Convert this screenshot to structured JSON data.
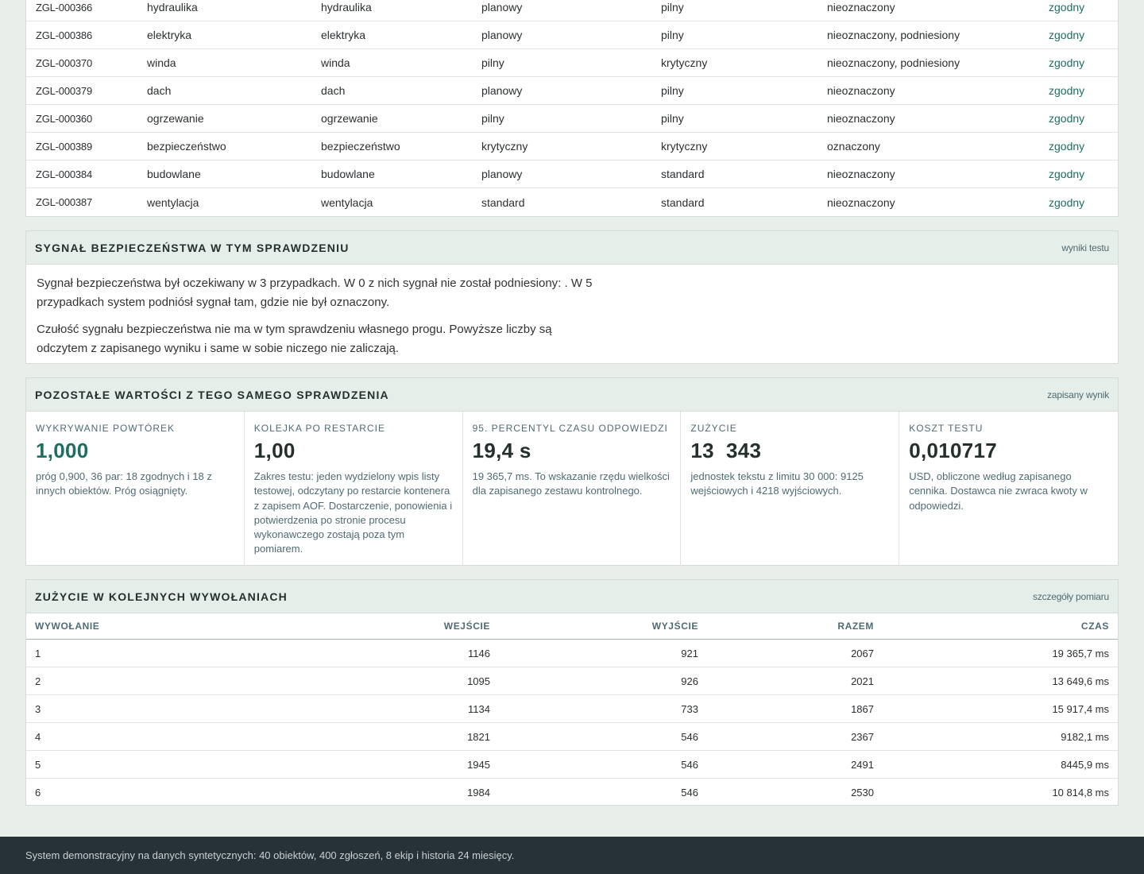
{
  "cases": [
    {
      "id": "ZGL-000366",
      "c2": "hydraulika",
      "c3": "hydraulika",
      "c4": "planowy",
      "c5": "pilny",
      "c6": "nieoznaczony",
      "c7": "zgodny"
    },
    {
      "id": "ZGL-000386",
      "c2": "elektryka",
      "c3": "elektryka",
      "c4": "planowy",
      "c5": "pilny",
      "c6": "nieoznaczony, podniesiony",
      "c7": "zgodny"
    },
    {
      "id": "ZGL-000370",
      "c2": "winda",
      "c3": "winda",
      "c4": "pilny",
      "c5": "krytyczny",
      "c6": "nieoznaczony, podniesiony",
      "c7": "zgodny"
    },
    {
      "id": "ZGL-000379",
      "c2": "dach",
      "c3": "dach",
      "c4": "planowy",
      "c5": "pilny",
      "c6": "nieoznaczony",
      "c7": "zgodny"
    },
    {
      "id": "ZGL-000360",
      "c2": "ogrzewanie",
      "c3": "ogrzewanie",
      "c4": "pilny",
      "c5": "pilny",
      "c6": "nieoznaczony",
      "c7": "zgodny"
    },
    {
      "id": "ZGL-000389",
      "c2": "bezpieczeństwo",
      "c3": "bezpieczeństwo",
      "c4": "krytyczny",
      "c5": "krytyczny",
      "c6": "oznaczony",
      "c7": "zgodny"
    },
    {
      "id": "ZGL-000384",
      "c2": "budowlane",
      "c3": "budowlane",
      "c4": "planowy",
      "c5": "standard",
      "c6": "nieoznaczony",
      "c7": "zgodny"
    },
    {
      "id": "ZGL-000387",
      "c2": "wentylacja",
      "c3": "wentylacja",
      "c4": "standard",
      "c5": "standard",
      "c6": "nieoznaczony",
      "c7": "zgodny"
    }
  ],
  "signal": {
    "title": "Sygnał bezpieczeństwa w tym sprawdzeniu",
    "tag": "wyniki testu",
    "p1": "Sygnał bezpieczeństwa był oczekiwany w 3 przypadkach. W 0 z nich sygnał nie został podniesiony: . W 5 przypadkach system podniósł sygnał tam, gdzie nie był oznaczony.",
    "p2": "Czułość sygnału bezpieczeństwa nie ma w tym sprawdzeniu własnego progu. Powyższe liczby są odczytem z zapisanego wyniku i same w sobie niczego nie zaliczają."
  },
  "other": {
    "title": "Pozostałe wartości z tego samego sprawdzenia",
    "tag": "zapisany wynik",
    "metrics": [
      {
        "label": "Wykrywanie powtórek",
        "value": "1,000",
        "desc": "próg 0,900, 36 par: 18 zgodnych i 18 z innych obiektów. Próg osiągnięty."
      },
      {
        "label": "Kolejka po restarcie",
        "value": "1,00",
        "desc": "Zakres testu: jeden wydzielony wpis listy testowej, odczytany po restarcie kontenera z zapisem AOF. Dostarczenie, ponowienia i potwierdzenia po stronie procesu wykonawczego zostają poza tym pomiarem."
      },
      {
        "label": "95. percentyl czasu odpowiedzi",
        "value": "19,4 s",
        "desc": "19 365,7 ms. To wskazanie rzędu wielkości dla zapisanego zestawu kontrolnego."
      },
      {
        "label": "Zużycie",
        "value": "13  343",
        "desc": "jednostek tekstu z limitu 30 000: 9125 wejściowych i 4218 wyjściowych."
      },
      {
        "label": "Koszt testu",
        "value": "0,010717",
        "desc": "USD, obliczone według zapisanego cennika. Dostawca nie zwraca kwoty w odpowiedzi."
      }
    ]
  },
  "usage": {
    "title": "Zużycie w kolejnych wywołaniach",
    "tag": "szczegóły pomiaru",
    "headers": [
      "WYWOŁANIE",
      "WEJŚCIE",
      "WYJŚCIE",
      "RAZEM",
      "CZAS"
    ],
    "rows": [
      [
        "1",
        "1146",
        "921",
        "2067",
        "19 365,7 ms"
      ],
      [
        "2",
        "1095",
        "926",
        "2021",
        "13 649,6 ms"
      ],
      [
        "3",
        "1134",
        "733",
        "1867",
        "15 917,4 ms"
      ],
      [
        "4",
        "1821",
        "546",
        "2367",
        "9182,1 ms"
      ],
      [
        "5",
        "1945",
        "546",
        "2491",
        "8445,9 ms"
      ],
      [
        "6",
        "1984",
        "546",
        "2530",
        "10 814,8 ms"
      ]
    ]
  },
  "footer": "System demonstracyjny na danych syntetycznych: 40 obiektów, 400 zgłoszeń, 8 ekip i historia 24 miesięcy."
}
